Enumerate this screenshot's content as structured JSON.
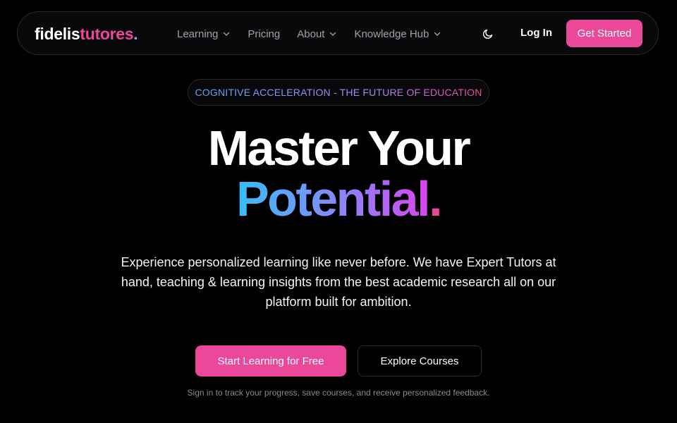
{
  "nav": {
    "logo": {
      "part1": "fidelis",
      "part2": "tutores",
      "part3": "."
    },
    "links": [
      {
        "label": "Learning",
        "has_dropdown": true
      },
      {
        "label": "Pricing",
        "has_dropdown": false
      },
      {
        "label": "About",
        "has_dropdown": true
      },
      {
        "label": "Knowledge Hub",
        "has_dropdown": true
      }
    ],
    "theme_icon": "moon-icon",
    "login_label": "Log In",
    "get_started_label": "Get Started"
  },
  "hero": {
    "badge": "COGNITIVE ACCELERATION - THE FUTURE OF EDUCATION",
    "title_line1": "Master Your",
    "title_line2": "Potential",
    "title_dot": ".",
    "description": "Experience personalized learning like never before. We have Expert Tutors at hand, teaching & learning insights from the best academic research all on our platform built for ambition.",
    "primary_cta": "Start Learning for Free",
    "secondary_cta": "Explore Courses",
    "note": "Sign in to track your progress, save courses, and receive personalized feedback."
  },
  "colors": {
    "accent": "#ec4899",
    "background": "#000000",
    "gradient_start": "#38bdf8",
    "gradient_end": "#d946ef"
  }
}
